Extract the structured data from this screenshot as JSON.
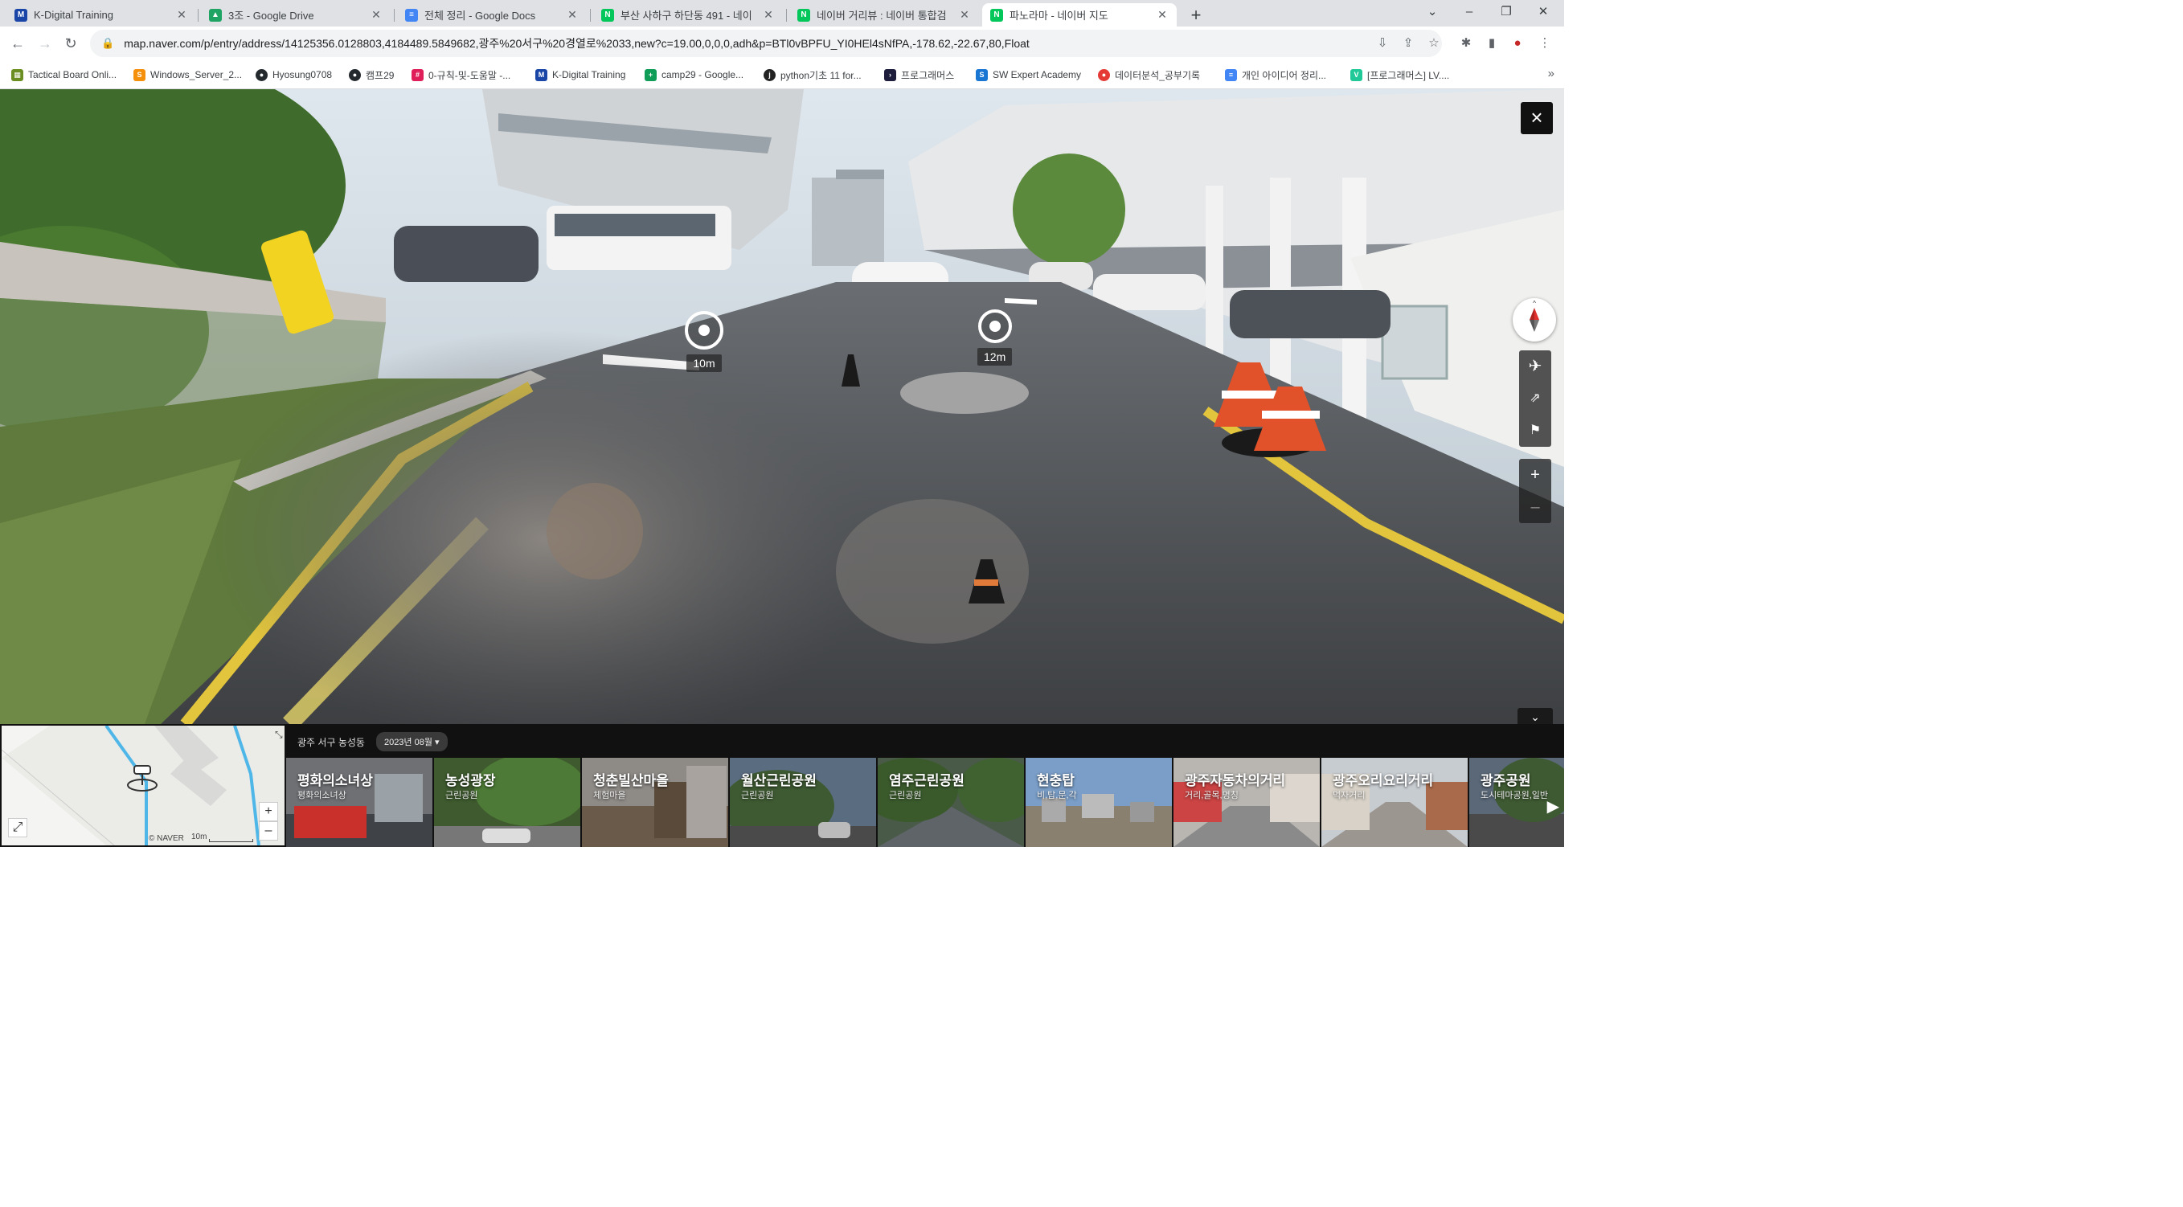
{
  "browser": {
    "tabs": [
      {
        "title": "K-Digital Training",
        "icon": "k-digital-icon",
        "color": "#1a46a8"
      },
      {
        "title": "3조 - Google Drive",
        "icon": "google-drive-icon",
        "color": "#1fa463"
      },
      {
        "title": "전체 정리 - Google Docs",
        "icon": "google-docs-icon",
        "color": "#4285f4"
      },
      {
        "title": "부산 사하구 하단동 491 - 네이",
        "icon": "naver-map-icon",
        "color": "#03c75a"
      },
      {
        "title": "네이버 거리뷰 : 네이버 통합검",
        "icon": "naver-icon",
        "color": "#03c75a"
      },
      {
        "title": "파노라마 - 네이버 지도",
        "icon": "naver-map-icon",
        "color": "#03c75a",
        "active": true
      }
    ],
    "new_tab": "+",
    "url": "map.naver.com/p/entry/address/14125356.0128803,4184489.5849682,광주%20서구%20경열로%2033,new?c=19.00,0,0,0,adh&p=BTl0vBPFU_YI0HEl4sNfPA,-178.62,-22.67,80,Float",
    "bookmarks": [
      {
        "label": "Tactical Board Onli...",
        "icon": "tactical-board-icon",
        "color": "#6b8e23"
      },
      {
        "label": "Windows_Server_2...",
        "icon": "windows-server-icon",
        "color": "#f4900c"
      },
      {
        "label": "Hyosung0708",
        "icon": "github-icon",
        "color": "#24292e"
      },
      {
        "label": "캠프29",
        "icon": "github-icon",
        "color": "#24292e"
      },
      {
        "label": "0-규칙-및-도움말 -...",
        "icon": "slack-icon",
        "color": "#e01e5a"
      },
      {
        "label": "K-Digital Training",
        "icon": "k-digital-icon",
        "color": "#1a46a8"
      },
      {
        "label": "camp29 - Google...",
        "icon": "google-sheets-icon",
        "color": "#0f9d58"
      },
      {
        "label": "python기초 11 for...",
        "icon": "python-icon",
        "color": "#222222"
      },
      {
        "label": "프로그래머스",
        "icon": "programmers-icon",
        "color": "#1e1e3c"
      },
      {
        "label": "SW Expert Academy",
        "icon": "swea-icon",
        "color": "#1976d2"
      },
      {
        "label": "데이터분석_공부기록",
        "icon": "record-icon",
        "color": "#e53935"
      },
      {
        "label": "개인 아이디어 정리...",
        "icon": "google-docs-icon",
        "color": "#4285f4"
      },
      {
        "label": "[프로그래머스] LV....",
        "icon": "velog-icon",
        "color": "#20c997"
      }
    ]
  },
  "panorama": {
    "hotspots": [
      {
        "label": "10m"
      },
      {
        "label": "12m"
      }
    ],
    "close": "×",
    "controls": [
      "airplane-icon",
      "share-icon",
      "report-icon",
      "zoom-in-icon",
      "zoom-out-icon"
    ]
  },
  "bottom": {
    "region": "광주 서구 농성동",
    "date": "2023년 08월 ▾",
    "minimap": {
      "scale": "10m",
      "brand": "© NAVER"
    },
    "cards": [
      {
        "title": "평화의소녀상",
        "subtitle": "평화의소녀상"
      },
      {
        "title": "농성광장",
        "subtitle": "근린공원"
      },
      {
        "title": "청춘빌산마을",
        "subtitle": "체험마을"
      },
      {
        "title": "월산근린공원",
        "subtitle": "근린공원"
      },
      {
        "title": "염주근린공원",
        "subtitle": "근린공원"
      },
      {
        "title": "현충탑",
        "subtitle": "비,탑,문,각"
      },
      {
        "title": "광주자동차의거리",
        "subtitle": "거리,골목,명칭"
      },
      {
        "title": "광주오리요리거리",
        "subtitle": "먹자거리"
      },
      {
        "title": "광주공원",
        "subtitle": "도시테마공원,일반"
      }
    ]
  }
}
